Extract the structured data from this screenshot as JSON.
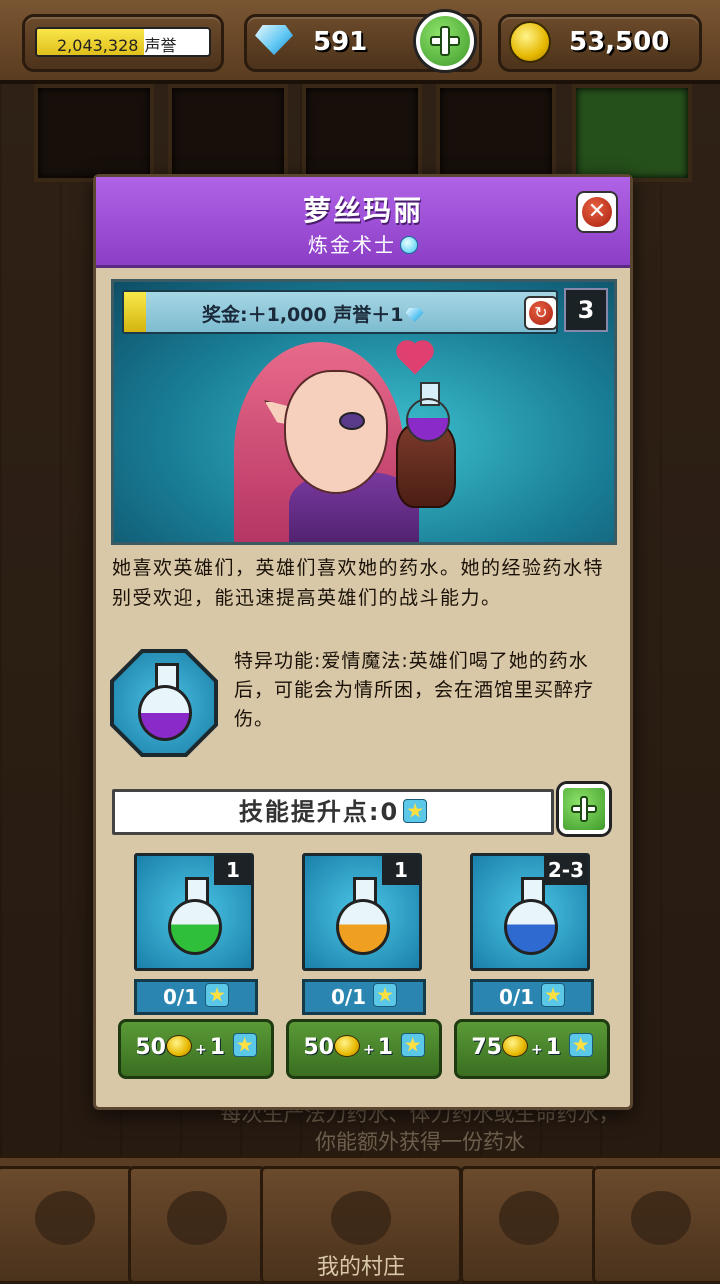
{
  "top_bar": {
    "reputation_value": "2,043,328",
    "reputation_label": "声誉",
    "reputation_fill": 0.62,
    "gems": "591",
    "gold": "53,500"
  },
  "background": {
    "description_line1": "每次生产法力药水、体力药水或生命药水，",
    "description_line2": "你能额外获得一份药水",
    "nav_center_label": "我的村庄"
  },
  "modal": {
    "title": "萝丝玛丽",
    "subtitle": "炼金术士",
    "bonus_text": "奖金:＋1,000 声誉＋1",
    "bonus_fill": 0.05,
    "level": "3",
    "description": "她喜欢英雄们，英雄们喜欢她的药水。她的经验药水特别受欢迎，能迅速提高英雄们的战斗能力。",
    "special_text": "特异功能:爱情魔法:英雄们喝了她的药水后，可能会为情所困，会在酒馆里买醉疗伤。",
    "skill_points_label": "技能提升点:0"
  },
  "potions": [
    {
      "level": "1",
      "progress": "0/1",
      "cost_gold": "50",
      "cost_points": "1",
      "liquid_color": "#2fbf3a",
      "heart_color": "#6ad04a"
    },
    {
      "level": "1",
      "progress": "0/1",
      "cost_gold": "50",
      "cost_points": "1",
      "liquid_color": "#f0a020",
      "heart_color": ""
    },
    {
      "level": "2-3",
      "progress": "0/1",
      "cost_gold": "75",
      "cost_points": "1",
      "liquid_color": "#2f6ad0",
      "heart_color": "#3a8ae0"
    }
  ],
  "colors": {
    "modal_header": "#9b4ad8",
    "button_green": "#4a8a2c"
  }
}
